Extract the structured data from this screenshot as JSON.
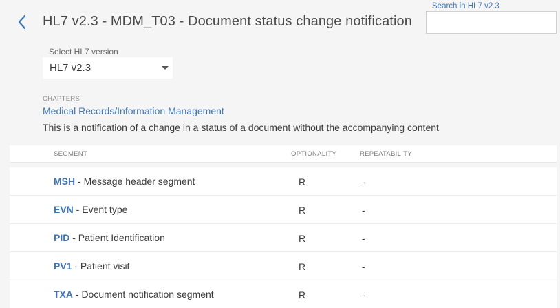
{
  "header": {
    "title": "HL7 v2.3 - MDM_T03 - Document status change notification",
    "search_label": "Search in HL7 v2.3",
    "search_value": "",
    "search_placeholder": ""
  },
  "version_select": {
    "label": "Select HL7 version",
    "selected": "HL7 v2.3"
  },
  "chapters": {
    "label": "CHAPTERS",
    "link": "Medical Records/Information Management",
    "description": "This is a notification of a change in a status of a document without the accompanying content"
  },
  "table": {
    "headers": {
      "segment": "SEGMENT",
      "optionality": "OPTIONALITY",
      "repeatability": "REPEATABILITY"
    },
    "rows": [
      {
        "code": "MSH",
        "desc": " - Message header segment",
        "optionality": "R",
        "repeatability": "-"
      },
      {
        "code": "EVN",
        "desc": " - Event type",
        "optionality": "R",
        "repeatability": "-"
      },
      {
        "code": "PID",
        "desc": " - Patient Identification",
        "optionality": "R",
        "repeatability": "-"
      },
      {
        "code": "PV1",
        "desc": " - Patient visit",
        "optionality": "R",
        "repeatability": "-"
      },
      {
        "code": "TXA",
        "desc": " - Document notification segment",
        "optionality": "R",
        "repeatability": "-"
      }
    ]
  },
  "icons": {
    "back": "chevron-left-icon",
    "dropdown": "caret-down-icon"
  },
  "colors": {
    "link": "#3f76b8",
    "background": "#f5f5f5",
    "surface": "#ffffff"
  }
}
